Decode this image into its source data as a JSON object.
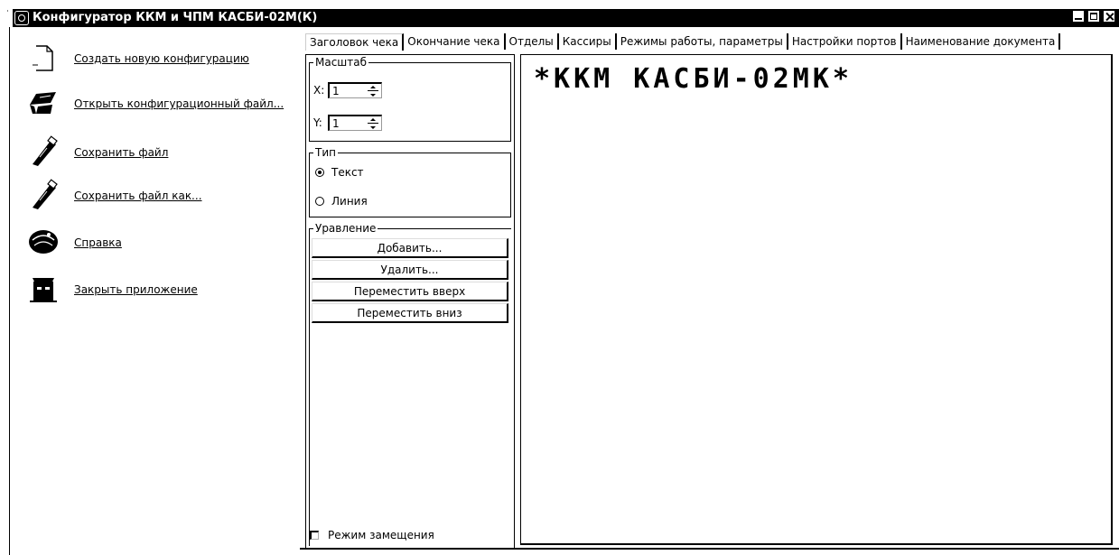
{
  "window": {
    "title": "Конфигуратор ККМ и ЧПМ КАСБИ-02М(К)"
  },
  "left_menu": {
    "items": [
      {
        "label": "Создать новую конфигурацию",
        "icon": "new-file-icon"
      },
      {
        "label": "Открыть конфигурационный файл...",
        "icon": "open-folder-icon"
      },
      {
        "label": "Сохранить файл",
        "icon": "save-usb-icon"
      },
      {
        "label": "Сохранить файл как...",
        "icon": "save-as-usb-icon"
      },
      {
        "label": "Справка",
        "icon": "help-book-icon"
      },
      {
        "label": "Закрыть приложение",
        "icon": "exit-icon"
      }
    ]
  },
  "tabs": [
    {
      "label": "Заголовок чека",
      "active": true
    },
    {
      "label": "Окончание чека"
    },
    {
      "label": "Отделы"
    },
    {
      "label": "Кассиры"
    },
    {
      "label": "Режимы работы, параметры"
    },
    {
      "label": "Настройки портов"
    },
    {
      "label": "Наименование документа"
    }
  ],
  "controls": {
    "scale": {
      "legend": "Масштаб",
      "x_label": "X:",
      "x_value": "1",
      "y_label": "Y:",
      "y_value": "1"
    },
    "type": {
      "legend": "Тип",
      "options": [
        {
          "label": "Текст",
          "selected": true
        },
        {
          "label": "Линия",
          "selected": false
        }
      ]
    },
    "management": {
      "legend": "Уравление",
      "buttons": [
        "Добавить...",
        "Удалить...",
        "Переместить вверх",
        "Переместить вниз"
      ]
    },
    "replace_mode": {
      "label": "Режим замещения",
      "checked": false
    }
  },
  "preview": {
    "lines": [
      "*ККМ  КАСБИ-02МК*"
    ]
  },
  "colors": {
    "titlebar": "#000000",
    "background": "#ffffff"
  }
}
